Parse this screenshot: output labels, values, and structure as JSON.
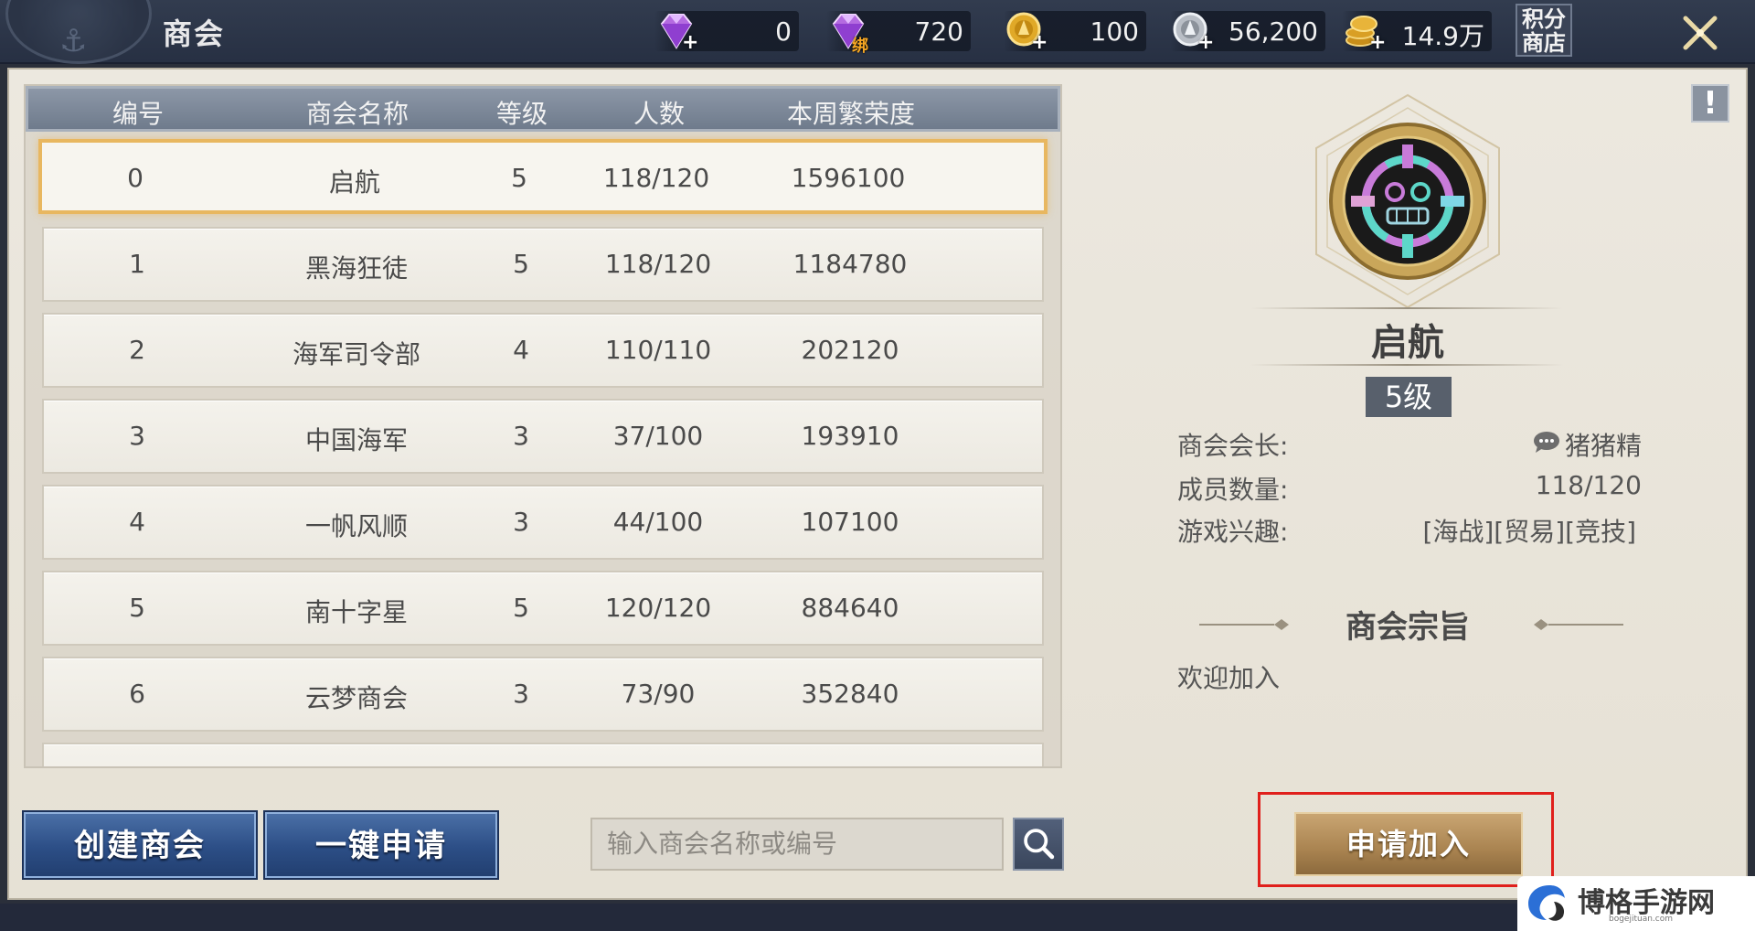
{
  "header": {
    "title": "商会",
    "currencies": [
      {
        "icon": "diamond-icon",
        "value": "0"
      },
      {
        "icon": "bound-diamond-icon",
        "tag": "绑",
        "value": "720"
      },
      {
        "icon": "gold-coin-icon",
        "value": "100"
      },
      {
        "icon": "silver-coin-icon",
        "value": "56,200"
      },
      {
        "icon": "coin-stack-icon",
        "value": "14.9万"
      }
    ],
    "shop_label_line1": "积分",
    "shop_label_line2": "商店"
  },
  "table": {
    "columns": [
      "编号",
      "商会名称",
      "等级",
      "人数",
      "本周繁荣度"
    ],
    "rows": [
      {
        "id": "0",
        "name": "启航",
        "level": "5",
        "members": "118/120",
        "prosperity": "1596100"
      },
      {
        "id": "1",
        "name": "黑海狂徒",
        "level": "5",
        "members": "118/120",
        "prosperity": "1184780"
      },
      {
        "id": "2",
        "name": "海军司令部",
        "level": "4",
        "members": "110/110",
        "prosperity": "202120"
      },
      {
        "id": "3",
        "name": "中国海军",
        "level": "3",
        "members": "37/100",
        "prosperity": "193910"
      },
      {
        "id": "4",
        "name": "一帆风顺",
        "level": "3",
        "members": "44/100",
        "prosperity": "107100"
      },
      {
        "id": "5",
        "name": "南十字星",
        "level": "5",
        "members": "120/120",
        "prosperity": "884640"
      },
      {
        "id": "6",
        "name": "云梦商会",
        "level": "3",
        "members": "73/90",
        "prosperity": "352840"
      }
    ],
    "selected_index": 0
  },
  "actions": {
    "create_label": "创建商会",
    "quick_apply_label": "一键申请",
    "search_placeholder": "输入商会名称或编号",
    "apply_label": "申请加入"
  },
  "detail": {
    "help_label": "!",
    "name": "启航",
    "level": "5级",
    "leader_label": "商会会长:",
    "leader_value": "猪猪精",
    "members_label": "成员数量:",
    "members_value": "118/120",
    "interests_label": "游戏兴趣:",
    "interests_value": "[海战][贸易][竞技]",
    "motto_title": "商会宗旨",
    "motto_text": "欢迎加入"
  },
  "watermark": {
    "text": "博格手游网",
    "sub": "bogejituan.com"
  },
  "colors": {
    "selected_border": "#e8b760",
    "apply_highlight": "#e0201c",
    "blue_button": "#2c4e86",
    "gold_button": "#a98350"
  }
}
